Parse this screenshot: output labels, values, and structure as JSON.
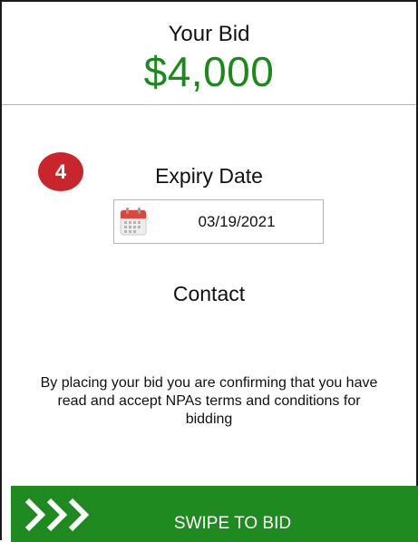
{
  "header": {
    "bid_label": "Your Bid",
    "bid_amount": "$4,000"
  },
  "step": {
    "number": "4"
  },
  "expiry": {
    "label": "Expiry Date",
    "date_value": "03/19/2021",
    "icon": "calendar-icon"
  },
  "contact": {
    "label": "Contact"
  },
  "terms": {
    "text": "By placing your bid you are confirming that you have read and accept NPAs terms and conditions for bidding"
  },
  "swipe": {
    "label": "SWIPE TO BID",
    "icon": "chevrons-right-icon"
  },
  "colors": {
    "accent_green": "#1a8a1a",
    "swipe_green": "#1f8a1f",
    "badge_red": "#c8262c"
  }
}
